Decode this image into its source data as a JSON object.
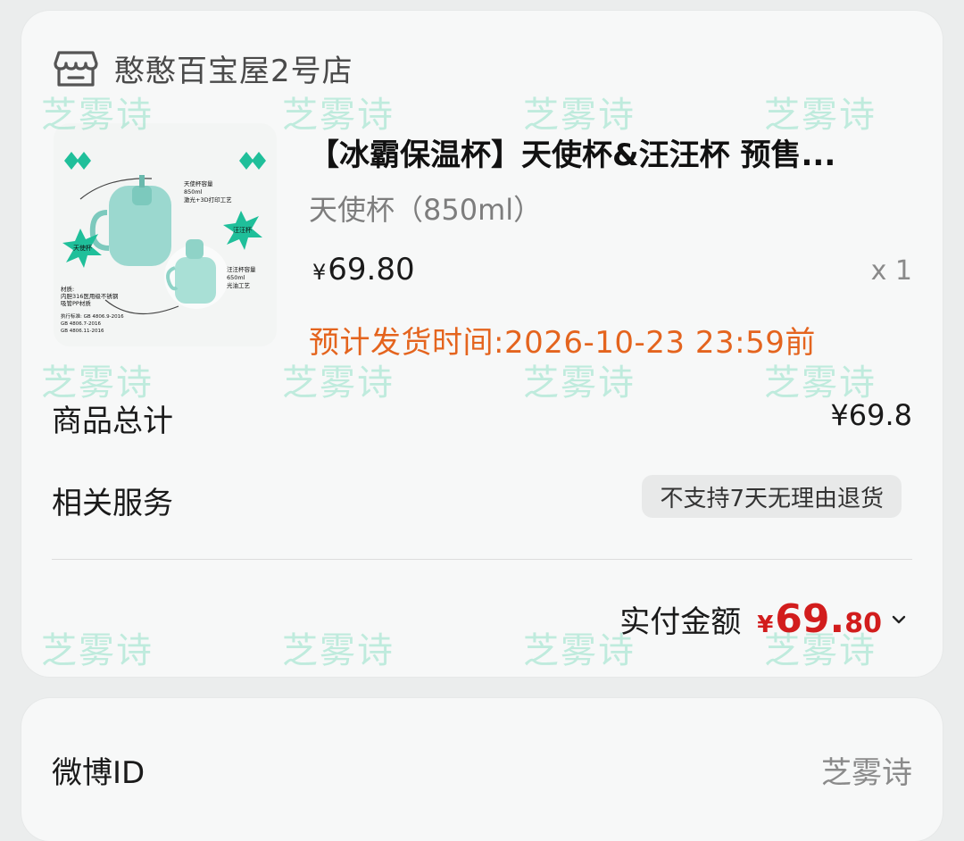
{
  "shop": {
    "name": "憨憨百宝屋2号店",
    "icon": "store-icon"
  },
  "product": {
    "title": "【冰霸保温杯】天使杯&汪汪杯 预售...",
    "variant": "天使杯（850ml）",
    "price_symbol": "¥",
    "price": "69.80",
    "quantity": "x 1",
    "ship_time": "预计发货时间:2026-10-23 23:59前",
    "image": {
      "tag_left": "天使杯",
      "tag_right": "汪汪杯",
      "angel_spec": [
        "天使杯容量",
        "850ml",
        "激光+3D打印工艺"
      ],
      "wang_spec": [
        "汪汪杯容量",
        "650ml",
        "光油工艺"
      ],
      "material": [
        "材质:",
        "内胆316医用级不锈钢",
        "吸管PP材质"
      ],
      "standard": [
        "执行标准: GB 4806.9-2016",
        "GB 4806.7-2016",
        "GB 4806.11-2016"
      ]
    }
  },
  "summary": {
    "total_label": "商品总计",
    "total_value": "¥69.8",
    "service_label": "相关服务",
    "service_badge": "不支持7天无理由退货",
    "paid_label": "实付金额",
    "paid_symbol": "¥",
    "paid_int": "69.",
    "paid_dec": "80"
  },
  "info": {
    "weibo_label": "微博ID",
    "weibo_value": "芝雾诗"
  },
  "watermark": {
    "text": "芝雾诗",
    "color": "#40cda0"
  },
  "colors": {
    "ship_orange": "#e4641e",
    "paid_red": "#d21d1d"
  }
}
